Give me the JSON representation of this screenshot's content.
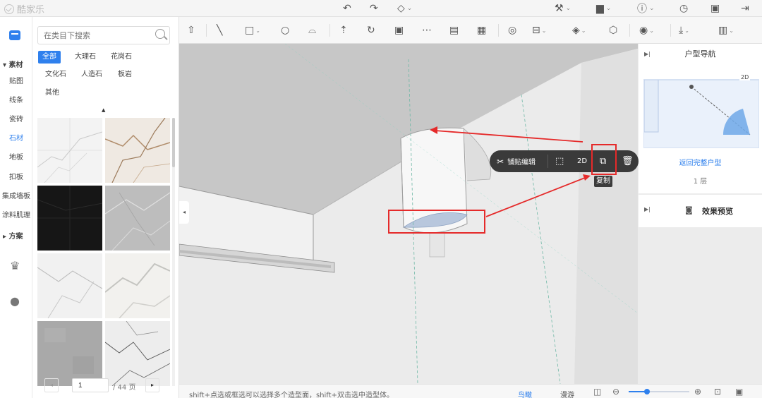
{
  "app": {
    "logo_text": "酷家乐"
  },
  "topbar": {
    "icons": [
      {
        "name": "undo-icon",
        "glyph": "↶",
        "dropdown": false
      },
      {
        "name": "redo-icon",
        "glyph": "↷",
        "dropdown": false
      },
      {
        "name": "eraser-icon",
        "glyph": "◇",
        "dropdown": true
      },
      {
        "name": "wrench-icon",
        "glyph": "🔧",
        "dropdown": true
      },
      {
        "name": "save-icon",
        "glyph": "▆",
        "dropdown": true
      },
      {
        "name": "help-icon",
        "glyph": "?",
        "dropdown": true
      },
      {
        "name": "history-clock-icon",
        "glyph": "◷",
        "dropdown": false
      },
      {
        "name": "document-icon",
        "glyph": "▢",
        "dropdown": false
      },
      {
        "name": "exit-icon",
        "glyph": "⇥",
        "dropdown": false
      }
    ]
  },
  "rail": {
    "section_material": "素材",
    "items": [
      "贴图",
      "线条",
      "瓷砖",
      "石材",
      "地板",
      "扣板",
      "集成墙板",
      "涂料肌理"
    ],
    "active_item": "石材",
    "section_plan": "方案"
  },
  "panel": {
    "search_placeholder": "在类目下搜索",
    "tags": [
      "全部",
      "大理石",
      "花岗石",
      "文化石",
      "人造石",
      "板岩",
      "其他"
    ],
    "active_tag": "全部",
    "pager": {
      "current": "1",
      "total": "/ 44 页"
    }
  },
  "toolbar": {
    "groups": [
      [
        "export-icon",
        "line-icon",
        "rectangle-icon",
        "circle-icon",
        "arc-icon"
      ],
      [
        "push-pull-icon",
        "rotate-icon",
        "offset-icon",
        "align-icon",
        "panel-icon",
        "panel2-icon"
      ],
      [
        "camera-icon",
        "level-icon",
        "paint-icon",
        "material-icon"
      ],
      [
        "eye-icon"
      ],
      [
        "download-icon",
        "map-icon"
      ]
    ]
  },
  "context_toolbar": {
    "paste_edit_label": "铺贴编辑",
    "mode_2d_label": "2D",
    "tooltip": "复制"
  },
  "right_panel": {
    "nav_title": "户型导航",
    "mini_badge": "2D",
    "back_link": "返回完整户型",
    "floor_label": "1 层",
    "preview_label": "效果预览"
  },
  "status": {
    "hint": "shift+点选或框选可以选择多个造型面，shift+双击选中造型体。",
    "bird_view": "鸟瞰",
    "roam": "漫游",
    "zoom_level": 0.3
  },
  "colors": {
    "accent": "#2f80ed",
    "annotation_red": "#e52a2a",
    "dark_bar": "#3a3a3a"
  }
}
